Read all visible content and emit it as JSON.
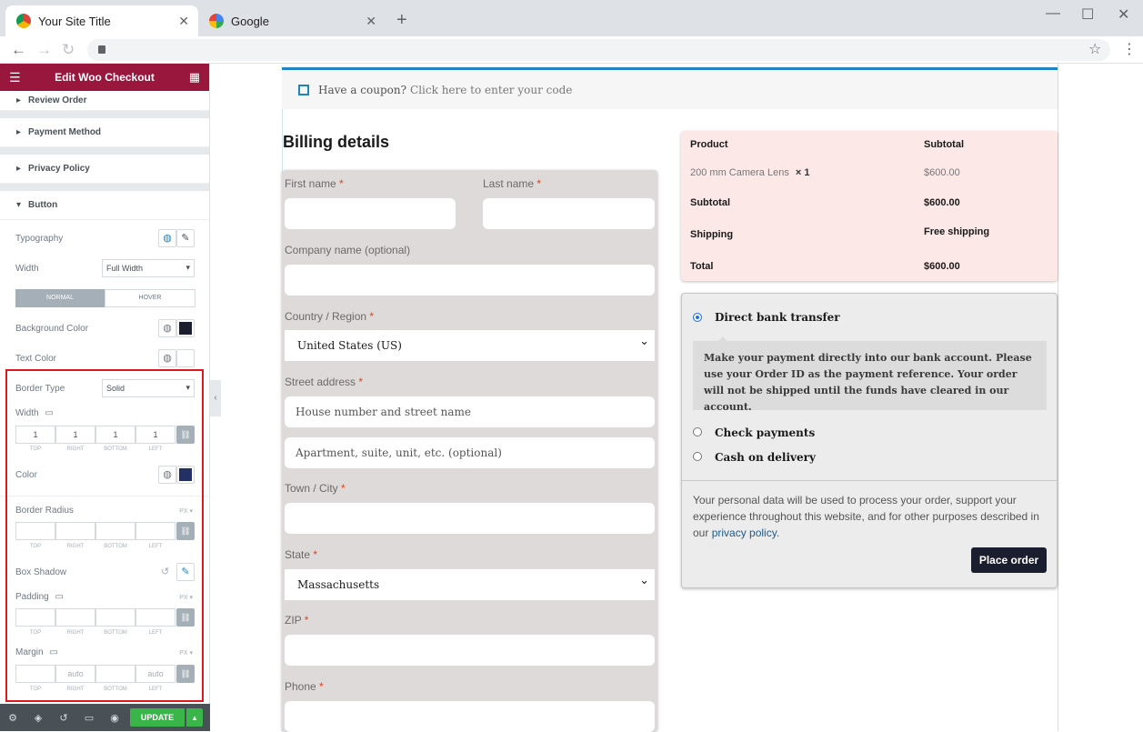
{
  "browser": {
    "tabs": [
      {
        "title": "Your Site Title"
      },
      {
        "title": "Google"
      }
    ],
    "new_tab_glyph": "+",
    "window_controls": {
      "minimize": "—",
      "maximize": "☐",
      "close": "✕"
    },
    "nav": {
      "back": "←",
      "forward": "→",
      "reload": "↻"
    }
  },
  "editor": {
    "header_title": "Edit Woo Checkout",
    "sections": [
      "Review Order",
      "Payment Method",
      "Privacy Policy",
      "Button"
    ],
    "typography_label": "Typography",
    "width_label": "Width",
    "width_value": "Full Width",
    "state_tabs": [
      "NORMAL",
      "HOVER"
    ],
    "background_color_label": "Background Color",
    "background_color": "#1b1e2e",
    "text_color_label": "Text Color",
    "text_color": "#ffffff",
    "border_type_label": "Border Type",
    "border_type_value": "Solid",
    "border_width_label": "Width",
    "border_width_values": [
      "1",
      "1",
      "1",
      "1"
    ],
    "dim_labels": [
      "TOP",
      "RIGHT",
      "BOTTOM",
      "LEFT"
    ],
    "border_color_label": "Color",
    "border_color": "#233066",
    "border_radius_label": "Border Radius",
    "box_shadow_label": "Box Shadow",
    "padding_label": "Padding",
    "margin_label": "Margin",
    "margin_values": [
      "",
      "auto",
      "",
      "auto"
    ],
    "units": "PX",
    "update_label": "UPDATE",
    "highlight_color": "#e0181e"
  },
  "checkout": {
    "coupon_text": "Have a coupon?",
    "coupon_link": "Click here to enter your code",
    "billing_title": "Billing details",
    "fields": {
      "first_name": "First name",
      "last_name": "Last name",
      "company": "Company name (optional)",
      "country": "Country / Region",
      "country_value": "United States (US)",
      "street": "Street address",
      "street_placeholder": "House number and street name",
      "street2_placeholder": "Apartment, suite, unit, etc. (optional)",
      "city": "Town / City",
      "state": "State",
      "state_value": "Massachusetts",
      "zip": "ZIP",
      "phone": "Phone",
      "required": "*"
    },
    "order": {
      "col_product": "Product",
      "col_subtotal": "Subtotal",
      "item_name": "200 mm Camera Lens",
      "item_qty": "× 1",
      "item_price": "$600.00",
      "subtotal_label": "Subtotal",
      "subtotal_value": "$600.00",
      "shipping_label": "Shipping",
      "shipping_value": "Free shipping",
      "total_label": "Total",
      "total_value": "$600.00"
    },
    "payment": {
      "options": [
        "Direct bank transfer",
        "Check payments",
        "Cash on delivery"
      ],
      "bank_desc": "Make your payment directly into our bank account. Please use your Order ID as the payment reference. Your order will not be shipped until the funds have cleared in our account.",
      "privacy_text": "Your personal data will be used to process your order, support your experience throughout this website, and for other purposes described in our",
      "privacy_link": "privacy policy",
      "privacy_end": ".",
      "place_order": "Place order"
    }
  }
}
